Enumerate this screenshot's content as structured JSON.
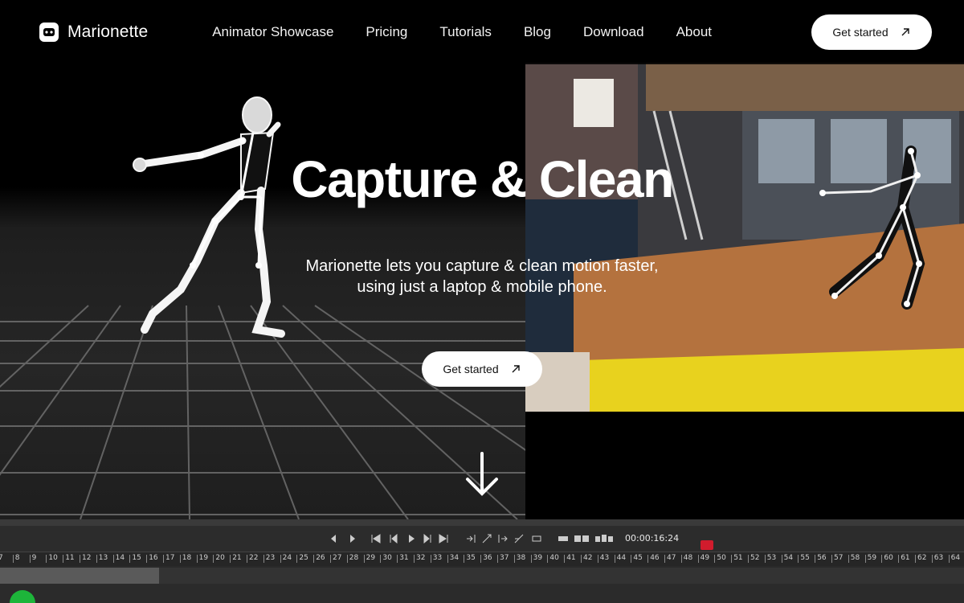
{
  "brand": {
    "name": "Marionette",
    "logo_icon": "marionette-logo-icon"
  },
  "nav": {
    "links": [
      "Animator Showcase",
      "Pricing",
      "Tutorials",
      "Blog",
      "Download",
      "About"
    ],
    "cta_label": "Get started",
    "cta_icon": "arrow-up-right-icon"
  },
  "hero": {
    "title": "Capture & Clean",
    "subtitle_line1": "Marionette lets you capture & clean motion faster,",
    "subtitle_line2": "using just a laptop & mobile phone.",
    "cta_label": "Get started",
    "scroll_icon": "arrow-down-icon"
  },
  "timeline": {
    "timecode": "00:00:16:24",
    "ruler_ticks": [
      "7",
      "8",
      "9",
      "10",
      "11",
      "12",
      "13",
      "14",
      "15",
      "16",
      "17",
      "18",
      "19",
      "20",
      "21",
      "22",
      "23",
      "24",
      "25",
      "26",
      "27",
      "28",
      "29",
      "30",
      "31",
      "32",
      "33",
      "34",
      "35",
      "36",
      "37",
      "38",
      "39",
      "40",
      "41",
      "42",
      "43",
      "44",
      "45",
      "46",
      "47",
      "48",
      "49",
      "50",
      "51",
      "52",
      "53",
      "54",
      "55",
      "56",
      "57",
      "58",
      "59",
      "60",
      "61",
      "62",
      "63",
      "64"
    ],
    "playhead_progress": 0.165
  },
  "colors": {
    "accent_green": "#1db53a",
    "record_red": "#d11c2d",
    "floor_yellow": "#e8d21e"
  }
}
